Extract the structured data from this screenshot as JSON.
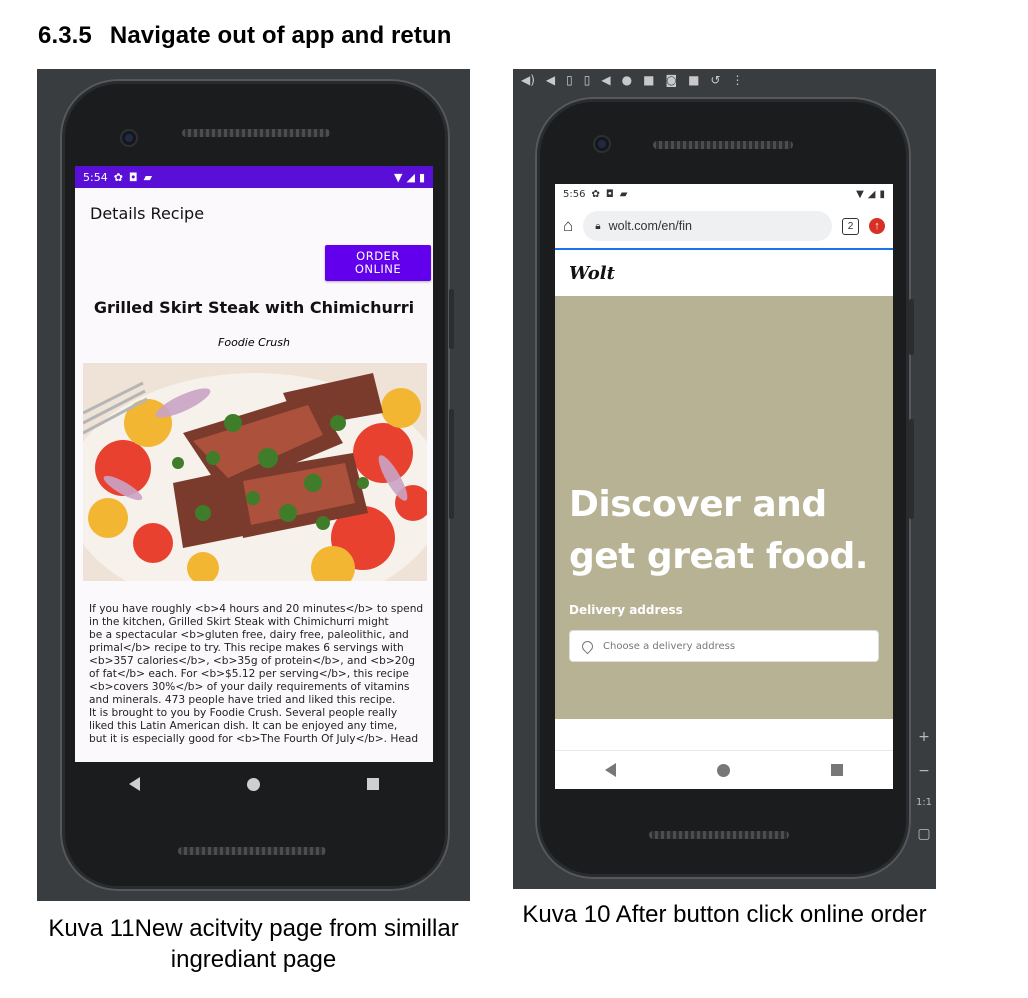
{
  "heading": {
    "number": "6.3.5",
    "text": "Navigate out of app and retun"
  },
  "left_phone": {
    "status_time": "5:54",
    "app_title": "Details Recipe",
    "order_button": "ORDER\nONLINE",
    "recipe_title": "Grilled Skirt Steak with Chimichurri",
    "recipe_source": "Foodie Crush",
    "recipe_text": "If you have roughly <b>4 hours and 20 minutes</b> to spend\nin the kitchen, Grilled Skirt Steak with Chimichurri might\nbe a spectacular <b>gluten free, dairy free, paleolithic, and\nprimal</b> recipe to try. This recipe makes 6 servings with\n<b>357 calories</b>, <b>35g of protein</b>, and <b>20g\nof fat</b> each. For <b>$5.12 per serving</b>, this recipe\n<b>covers 30%</b> of your daily requirements of vitamins\nand minerals. 473 people have tried and liked this recipe.\nIt is brought to you by Foodie Crush. Several people really\nliked this Latin American dish. It can be enjoyed any time,\nbut it is especially good for <b>The Fourth Of July</b>. Head",
    "statusbar_color": "#5a0fd6",
    "button_color": "#6200ee"
  },
  "right_phone": {
    "status_time": "5:56",
    "url": "wolt.com/en/fin",
    "tab_count": "2",
    "brand": "Wolt",
    "hero_title": "Discover and get great food.",
    "delivery_label": "Delivery address",
    "address_placeholder": "Choose a delivery address",
    "hero_color": "#b7b294",
    "side_zoom_label": "1:1"
  },
  "captions": {
    "left": "Kuva 11New acitvity page from simillar ingrediant page",
    "right": "Kuva 10 After button click online order"
  }
}
